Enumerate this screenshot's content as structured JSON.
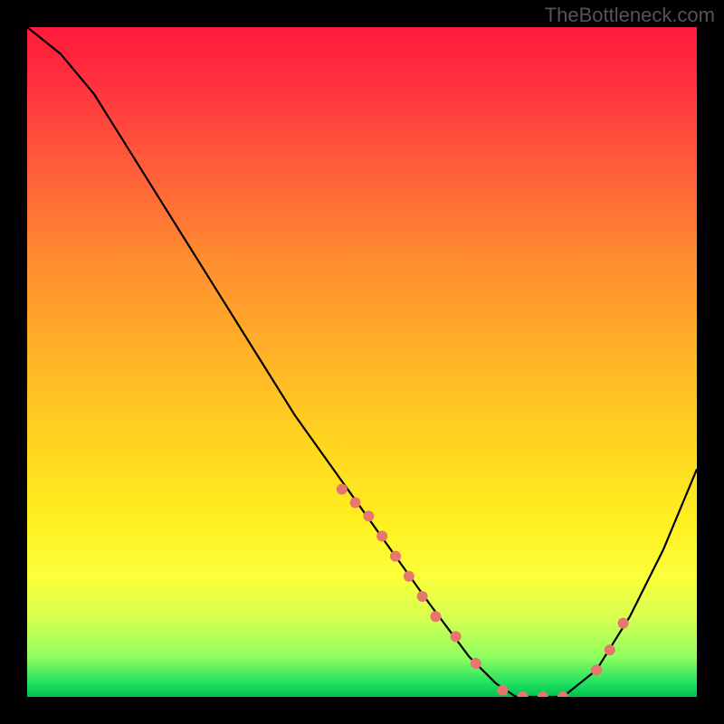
{
  "watermark": "TheBottleneck.com",
  "chart_data": {
    "type": "line",
    "title": "",
    "xlabel": "",
    "ylabel": "",
    "xlim": [
      0,
      100
    ],
    "ylim": [
      0,
      100
    ],
    "grid": false,
    "legend": false,
    "curve_color": "#000000",
    "marker_color": "#e7766e",
    "x": [
      0,
      5,
      10,
      15,
      20,
      25,
      30,
      35,
      40,
      45,
      50,
      55,
      60,
      63,
      66,
      70,
      73,
      76,
      80,
      85,
      90,
      95,
      100
    ],
    "y": [
      100,
      96,
      90,
      82,
      74,
      66,
      58,
      50,
      42,
      35,
      28,
      21,
      14,
      10,
      6,
      2,
      0,
      0,
      0,
      4,
      12,
      22,
      34
    ],
    "markers_x": [
      47,
      49,
      51,
      53,
      55,
      57,
      59,
      61,
      64,
      67,
      71,
      74,
      77,
      80,
      85,
      87,
      89
    ],
    "markers_y": [
      31,
      29,
      27,
      24,
      21,
      18,
      15,
      12,
      9,
      5,
      1,
      0,
      0,
      0,
      4,
      7,
      11
    ]
  }
}
